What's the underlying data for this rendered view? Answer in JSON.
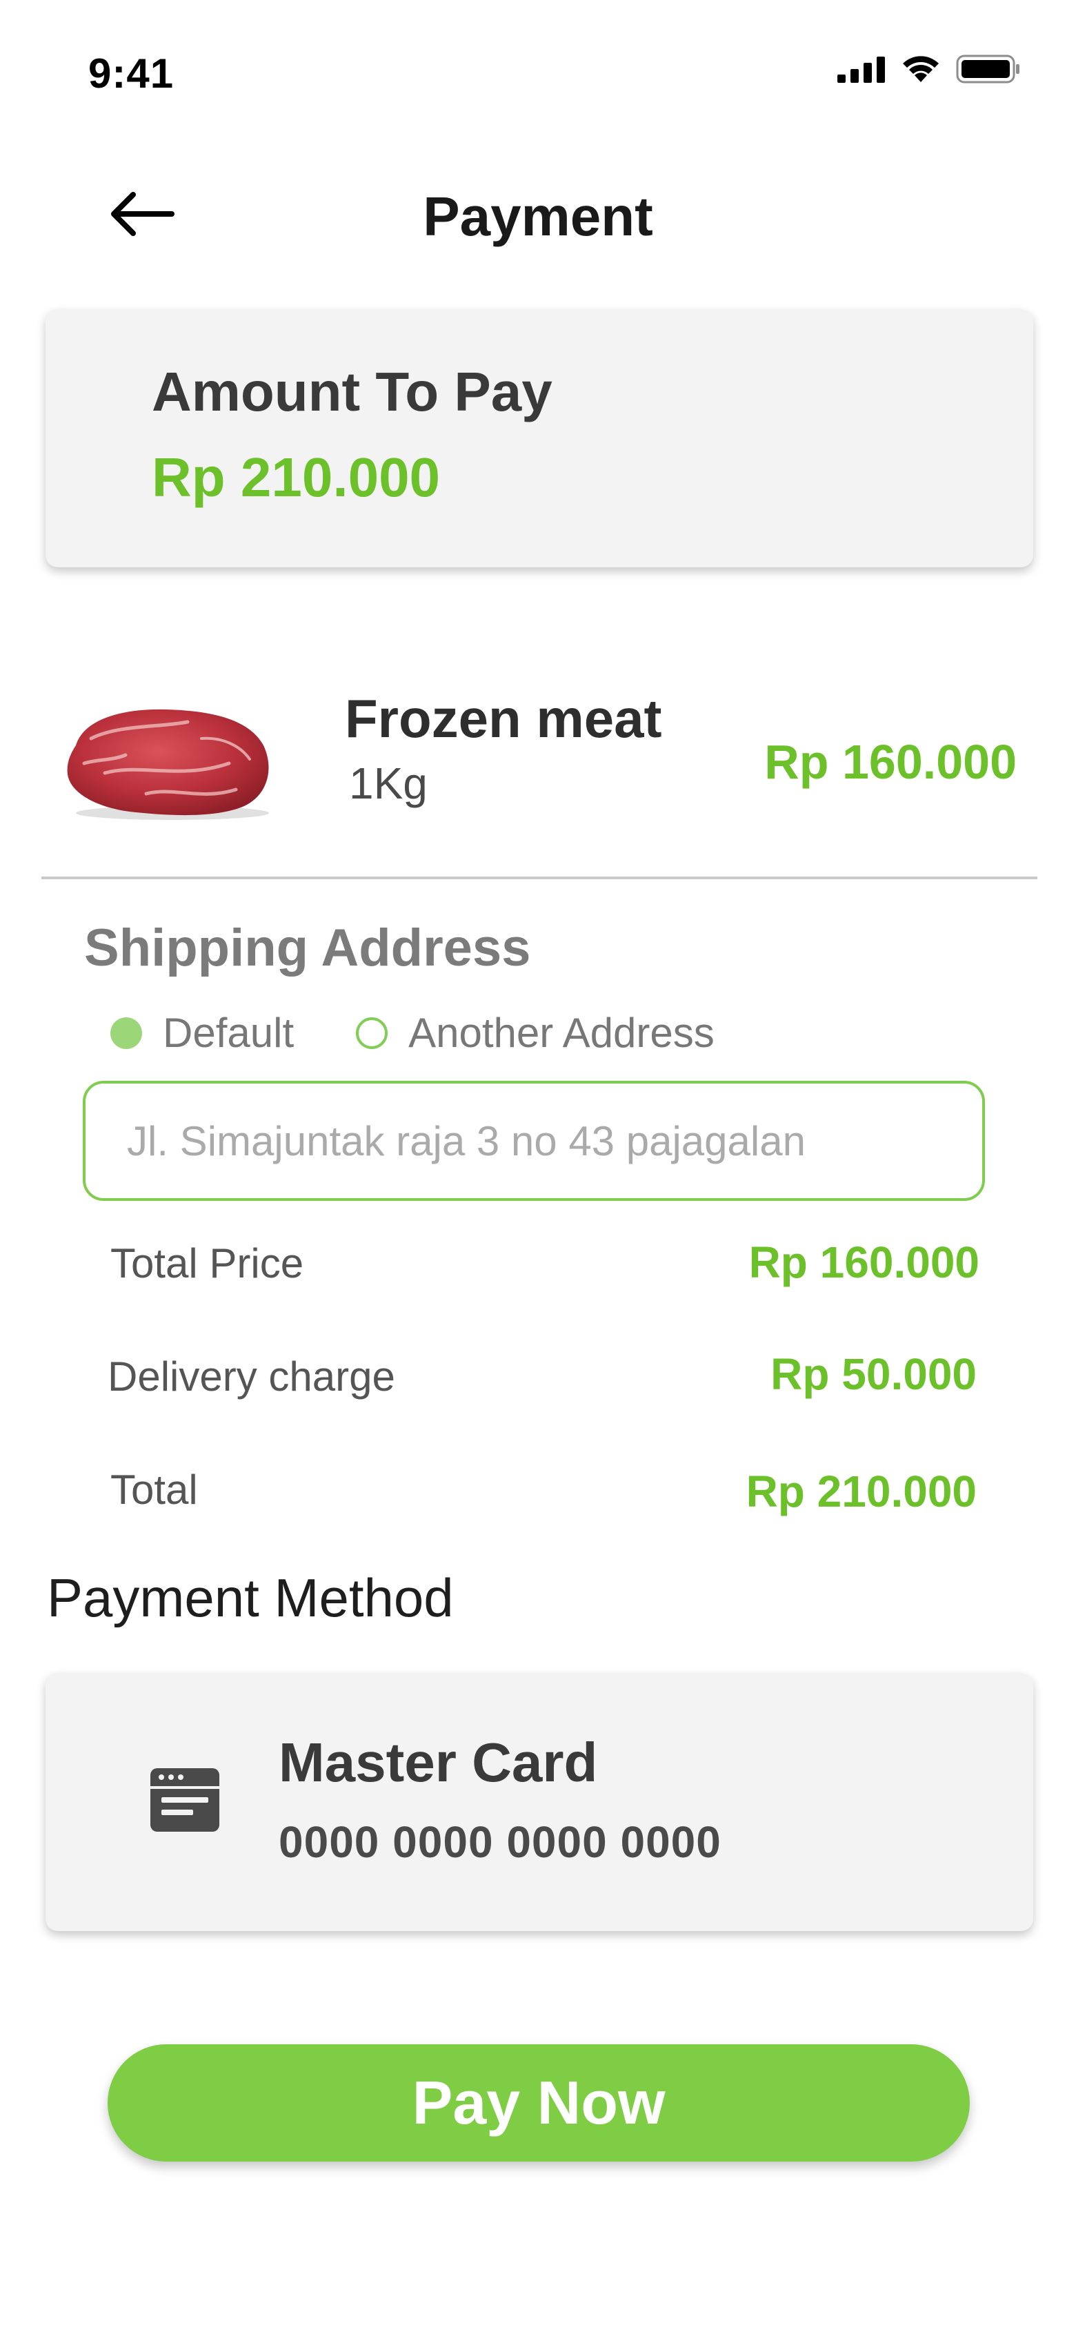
{
  "status_bar": {
    "time": "9:41",
    "icons": [
      "signal-icon",
      "wifi-icon",
      "battery-icon"
    ]
  },
  "header": {
    "title": "Payment",
    "back_icon": "arrow-left-icon"
  },
  "amount": {
    "label": "Amount To Pay",
    "value": "Rp 210.000"
  },
  "product": {
    "image": "frozen-meat-image",
    "name": "Frozen meat",
    "quantity": "1Kg",
    "price": "Rp 160.000"
  },
  "shipping": {
    "title": "Shipping Address",
    "options": [
      {
        "label": "Default",
        "selected": true
      },
      {
        "label": "Another Address",
        "selected": false
      }
    ],
    "address_placeholder": "Jl. Simajuntak raja 3 no 43 pajagalan"
  },
  "summary": {
    "total_price_label": "Total Price",
    "total_price_value": "Rp 160.000",
    "delivery_label": "Delivery charge",
    "delivery_value": "Rp 50.000",
    "total_label": "Total",
    "total_value": "Rp 210.000"
  },
  "payment_method": {
    "title": "Payment Method",
    "card_icon": "card-icon",
    "card_name": "Master Card",
    "card_number": "0000 0000 0000 0000"
  },
  "actions": {
    "pay_label": "Pay Now"
  },
  "colors": {
    "accent": "#6cc12b",
    "button": "#7fcc45",
    "card_bg": "#f3f3f3"
  }
}
